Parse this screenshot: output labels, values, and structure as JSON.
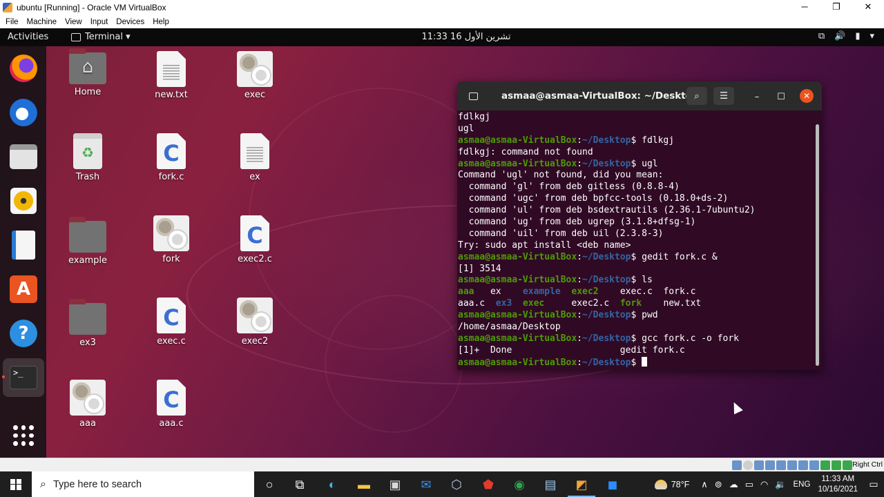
{
  "vbox": {
    "title": "ubuntu [Running] - Oracle VM VirtualBox",
    "menu": [
      "File",
      "Machine",
      "View",
      "Input",
      "Devices",
      "Help"
    ],
    "host_key": "Right Ctrl"
  },
  "topbar": {
    "activities": "Activities",
    "app_menu": "Terminal ▾",
    "clock": "11:33  16 تشرين الأول"
  },
  "desktop_icons": [
    {
      "label": "Home"
    },
    {
      "label": "new.txt"
    },
    {
      "label": "exec"
    },
    {
      "label": "Trash"
    },
    {
      "label": "fork.c"
    },
    {
      "label": "ex"
    },
    {
      "label": "example"
    },
    {
      "label": "fork"
    },
    {
      "label": "exec2.c"
    },
    {
      "label": "ex3"
    },
    {
      "label": "exec.c"
    },
    {
      "label": "exec2"
    },
    {
      "label": "aaa"
    },
    {
      "label": "aaa.c"
    }
  ],
  "cfile_letter": "C",
  "terminal": {
    "title": "asmaa@asmaa-VirtualBox: ~/Desktop",
    "prompt_user": "asmaa@asmaa-VirtualBox",
    "prompt_path": "~/Desktop",
    "lines": [
      {
        "text": "fdlkgj"
      },
      {
        "text": "ugl"
      },
      {
        "cmd": " fdlkgj"
      },
      {
        "text": "fdlkgj: command not found"
      },
      {
        "cmd": " ugl"
      },
      {
        "text": "Command 'ugl' not found, did you mean:"
      },
      {
        "text": "  command 'gl' from deb gitless (0.8.8-4)"
      },
      {
        "text": "  command 'ugc' from deb bpfcc-tools (0.18.0+ds-2)"
      },
      {
        "text": "  command 'ul' from deb bsdextrautils (2.36.1-7ubuntu2)"
      },
      {
        "text": "  command 'ug' from deb ugrep (3.1.8+dfsg-1)"
      },
      {
        "text": "  command 'uil' from deb uil (2.3.8-3)"
      },
      {
        "text": "Try: sudo apt install <deb name>"
      },
      {
        "cmd": " gedit fork.c &"
      },
      {
        "text": "[1] 3514"
      },
      {
        "cmd": " ls"
      },
      {
        "ls": [
          [
            "aaa",
            "exe"
          ],
          [
            "   ",
            ""
          ],
          [
            "ex",
            ""
          ],
          [
            "    ",
            ""
          ],
          [
            "example",
            "dir"
          ],
          [
            "  ",
            ""
          ],
          [
            "exec2",
            "exe"
          ],
          [
            "    ",
            ""
          ],
          [
            "exec.c",
            ""
          ],
          [
            "  ",
            ""
          ],
          [
            "fork.c",
            ""
          ]
        ]
      },
      {
        "ls": [
          [
            "aaa.c",
            ""
          ],
          [
            "  ",
            ""
          ],
          [
            "ex3",
            "dir"
          ],
          [
            "  ",
            ""
          ],
          [
            "exec",
            "exe"
          ],
          [
            "     ",
            ""
          ],
          [
            "exec2.c",
            ""
          ],
          [
            "  ",
            ""
          ],
          [
            "fork",
            "exe"
          ],
          [
            "    ",
            ""
          ],
          [
            "new.txt",
            ""
          ]
        ]
      },
      {
        "cmd": " pwd"
      },
      {
        "text": "/home/asmaa/Desktop"
      },
      {
        "cmd": " gcc fork.c -o fork"
      },
      {
        "text": "[1]+  Done                    gedit fork.c"
      },
      {
        "cmd": " ",
        "cursor": true
      }
    ]
  },
  "taskbar": {
    "search_placeholder": "Type here to search",
    "weather": "78°F",
    "lang": "ENG",
    "time": "11:33 AM",
    "date": "10/16/2021"
  },
  "colors": {
    "terminal_bg": "#300a24",
    "prompt_user": "#4e9a06",
    "prompt_path": "#3465a4",
    "ubuntu_orange": "#e95420"
  }
}
